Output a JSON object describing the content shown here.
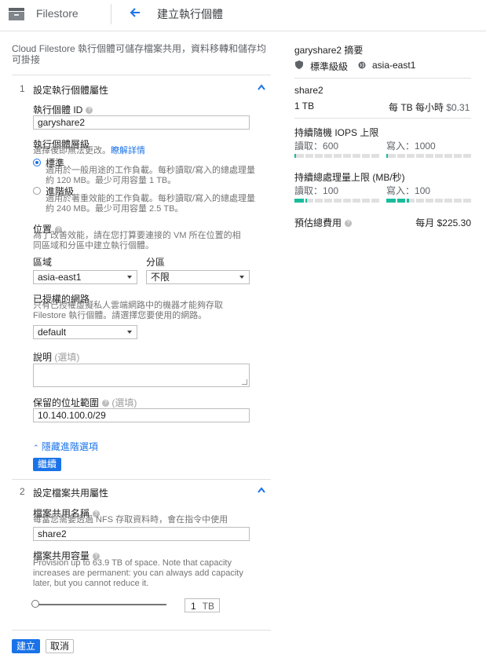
{
  "header": {
    "product": "Filestore",
    "title": "建立執行個體"
  },
  "intro": "Cloud Filestore 執行個體可儲存檔案共用，資料移轉和儲存均可掛接",
  "section1": {
    "num": "1",
    "title": "設定執行個體屬性",
    "instance_id_label": "執行個體 ID",
    "instance_id_value": "garyshare2",
    "tier_label": "執行個體層級",
    "tier_sub": "選擇後即無法更改。",
    "tier_link": "瞭解詳情",
    "tiers": [
      {
        "label": "標準",
        "desc": "適用於一般用途的工作負載。每秒讀取/寫入的總處理量約 120 MB。最少可用容量 1 TB。",
        "selected": true
      },
      {
        "label": "進階級",
        "desc": "適用於著重效能的工作負載。每秒讀取/寫入的總處理量約 240 MB。最少可用容量 2.5 TB。",
        "selected": false
      }
    ],
    "location_label": "位置",
    "location_sub": "為了改善效能，請在您打算要連接的 VM 所在位置的相同區域和分區中建立執行個體。",
    "region_label": "區域",
    "region_value": "asia-east1",
    "zone_label": "分區",
    "zone_value": "不限",
    "network_label": "已授權的網路",
    "network_sub": "只有已授權虛擬私人雲端網路中的機器才能夠存取 Filestore 執行個體。請選擇您要使用的網路。",
    "network_value": "default",
    "desc_label": "說明",
    "desc_optional": "(選填)",
    "ip_label": "保留的位址範圍",
    "ip_optional": "(選填)",
    "ip_value": "10.140.100.0/29",
    "advanced_link": "隱藏進階選項",
    "continue_btn": "繼續"
  },
  "section2": {
    "num": "2",
    "title": "設定檔案共用屬性",
    "share_name_label": "檔案共用名稱",
    "share_name_sub": "每當您需要透過 NFS 存取資料時，會在指令中使用",
    "share_name_value": "share2",
    "capacity_label": "檔案共用容量",
    "capacity_sub": "Provision up to 63.9 TB of space. Note that capacity increases are permanent: you can always add capacity later, but you cannot reduce it.",
    "capacity_value": "1",
    "capacity_unit": "TB",
    "slider_level": 0
  },
  "actions": {
    "create": "建立",
    "cancel": "取消"
  },
  "summary": {
    "title": "garyshare2 摘要",
    "tier": "標準級級",
    "region": "asia-east1",
    "share": "share2",
    "capacity": "1 TB",
    "price_label": "每 TB 每小時",
    "price": "$0.31",
    "iops_title": "持續隨機 IOPS 上限",
    "iops_read_label": "讀取：",
    "iops_read": "600",
    "iops_write_label": "寫入：",
    "iops_write": "1000",
    "iops_read_fraction": 0.02,
    "iops_write_fraction": 0.02,
    "tp_title": "持續總處理量上限 (MB/秒)",
    "tp_read_label": "讀取：",
    "tp_read": "100",
    "tp_write_label": "寫入：",
    "tp_write": "100",
    "tp_read_fraction": 0.15,
    "tp_write_fraction": 0.27,
    "cost_label": "預估總費用",
    "cost_value": "每月 $225.30"
  },
  "colors": {
    "accent": "#1a73e8",
    "bar_fill": "#1abc9c"
  }
}
